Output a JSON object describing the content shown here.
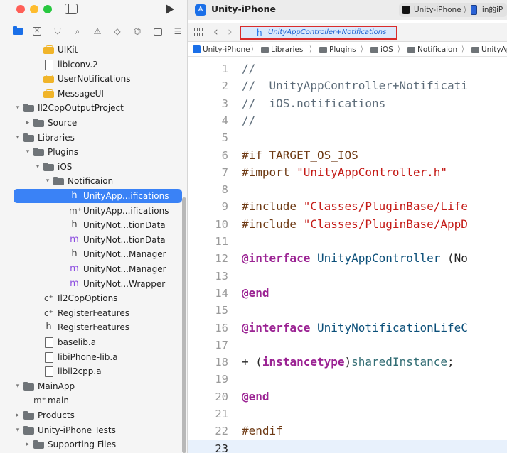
{
  "navigator": {
    "tree": [
      {
        "label": "UIKit",
        "icon": "framework-icon",
        "depth": 3,
        "chevron": ""
      },
      {
        "label": "libiconv.2",
        "icon": "file-icon",
        "depth": 3,
        "chevron": ""
      },
      {
        "label": "UserNotifications",
        "icon": "framework-icon",
        "depth": 3,
        "chevron": ""
      },
      {
        "label": "MessageUI",
        "icon": "framework-icon",
        "depth": 3,
        "chevron": ""
      },
      {
        "label": "Il2CppOutputProject",
        "icon": "folder-icon",
        "depth": 1,
        "chevron": "⌄"
      },
      {
        "label": "Source",
        "icon": "folder-icon",
        "depth": 2,
        "chevron": "›"
      },
      {
        "label": "Libraries",
        "icon": "folder-icon",
        "depth": 1,
        "chevron": "⌄"
      },
      {
        "label": "Plugins",
        "icon": "folder-icon",
        "depth": 2,
        "chevron": "⌄"
      },
      {
        "label": "iOS",
        "icon": "folder-icon",
        "depth": 3,
        "chevron": "⌄"
      },
      {
        "label": "Notificaion",
        "icon": "folder-icon",
        "depth": 4,
        "chevron": "⌄"
      },
      {
        "label": "UnityApp...ifications",
        "icon": "h-file-icon",
        "depth": 5,
        "chevron": "",
        "selected": true
      },
      {
        "label": "UnityApp...ifications",
        "icon": "mplus-file-icon",
        "depth": 5,
        "chevron": ""
      },
      {
        "label": "UnityNot...tionData",
        "icon": "h-file-icon",
        "depth": 5,
        "chevron": ""
      },
      {
        "label": "UnityNot...tionData",
        "icon": "m-file-icon",
        "depth": 5,
        "chevron": ""
      },
      {
        "label": "UnityNot...Manager",
        "icon": "h-file-icon",
        "depth": 5,
        "chevron": ""
      },
      {
        "label": "UnityNot...Manager",
        "icon": "m-file-icon",
        "depth": 5,
        "chevron": ""
      },
      {
        "label": "UnityNot...Wrapper",
        "icon": "m-file-icon",
        "depth": 5,
        "chevron": ""
      },
      {
        "label": "Il2CppOptions",
        "icon": "cplus-file-icon",
        "depth": 3,
        "chevron": ""
      },
      {
        "label": "RegisterFeatures",
        "icon": "cplus-file-icon",
        "depth": 3,
        "chevron": ""
      },
      {
        "label": "RegisterFeatures",
        "icon": "h-file-icon",
        "depth": 3,
        "chevron": ""
      },
      {
        "label": "baselib.a",
        "icon": "file-icon",
        "depth": 3,
        "chevron": ""
      },
      {
        "label": "libiPhone-lib.a",
        "icon": "file-icon",
        "depth": 3,
        "chevron": ""
      },
      {
        "label": "libil2cpp.a",
        "icon": "file-icon",
        "depth": 3,
        "chevron": ""
      },
      {
        "label": "MainApp",
        "icon": "folder-icon",
        "depth": 1,
        "chevron": "⌄"
      },
      {
        "label": "main",
        "icon": "mm-file-icon",
        "depth": 2,
        "chevron": ""
      },
      {
        "label": "Products",
        "icon": "folder-icon",
        "depth": 1,
        "chevron": "›"
      },
      {
        "label": "Unity-iPhone Tests",
        "icon": "folder-icon",
        "depth": 1,
        "chevron": "⌄"
      },
      {
        "label": "Supporting Files",
        "icon": "folder-icon",
        "depth": 2,
        "chevron": "›"
      }
    ]
  },
  "toolbar": {
    "scheme_title": "Unity-iPhone",
    "run_destination": {
      "scheme": "Unity-iPhone",
      "device": "lin的iP"
    }
  },
  "tabbar": {
    "active_tab_glyph": "h",
    "active_tab_label": "UnityAppController+Notifications"
  },
  "jumpbar": [
    "Unity-iPhone",
    "Libraries",
    "Plugins",
    "iOS",
    "Notificaion",
    "UnityApp"
  ],
  "editor": {
    "current_line": 23,
    "lines": [
      {
        "n": "1",
        "tokens": [
          {
            "t": "//",
            "c": "com"
          }
        ]
      },
      {
        "n": "2",
        "tokens": [
          {
            "t": "//  UnityAppController+Notificati",
            "c": "com"
          }
        ]
      },
      {
        "n": "3",
        "tokens": [
          {
            "t": "//  iOS.notifications",
            "c": "com"
          }
        ]
      },
      {
        "n": "4",
        "tokens": [
          {
            "t": "//",
            "c": "com"
          }
        ]
      },
      {
        "n": "5",
        "tokens": []
      },
      {
        "n": "6",
        "tokens": [
          {
            "t": "#if TARGET_OS_IOS",
            "c": "pre"
          }
        ]
      },
      {
        "n": "7",
        "tokens": [
          {
            "t": "#import ",
            "c": "pre"
          },
          {
            "t": "\"UnityAppController.h\"",
            "c": "str"
          }
        ]
      },
      {
        "n": "8",
        "tokens": []
      },
      {
        "n": "9",
        "tokens": [
          {
            "t": "#include ",
            "c": "pre"
          },
          {
            "t": "\"Classes/PluginBase/Life",
            "c": "str"
          }
        ]
      },
      {
        "n": "10",
        "tokens": [
          {
            "t": "#include ",
            "c": "pre"
          },
          {
            "t": "\"Classes/PluginBase/AppD",
            "c": "str"
          }
        ]
      },
      {
        "n": "11",
        "tokens": []
      },
      {
        "n": "12",
        "tokens": [
          {
            "t": "@interface",
            "c": "kw"
          },
          {
            "t": " ",
            "c": ""
          },
          {
            "t": "UnityAppController",
            "c": "type"
          },
          {
            "t": " (No",
            "c": ""
          }
        ]
      },
      {
        "n": "13",
        "tokens": []
      },
      {
        "n": "14",
        "tokens": [
          {
            "t": "@end",
            "c": "kw"
          }
        ]
      },
      {
        "n": "15",
        "tokens": []
      },
      {
        "n": "16",
        "tokens": [
          {
            "t": "@interface",
            "c": "kw"
          },
          {
            "t": " ",
            "c": ""
          },
          {
            "t": "UnityNotificationLifeC",
            "c": "type"
          }
        ]
      },
      {
        "n": "17",
        "tokens": []
      },
      {
        "n": "18",
        "tokens": [
          {
            "t": "+ (",
            "c": ""
          },
          {
            "t": "instancetype",
            "c": "kw"
          },
          {
            "t": ")",
            "c": ""
          },
          {
            "t": "sharedInstance",
            "c": "sel"
          },
          {
            "t": ";",
            "c": ""
          }
        ]
      },
      {
        "n": "19",
        "tokens": []
      },
      {
        "n": "20",
        "tokens": [
          {
            "t": "@end",
            "c": "kw"
          }
        ]
      },
      {
        "n": "21",
        "tokens": []
      },
      {
        "n": "22",
        "tokens": [
          {
            "t": "#endif",
            "c": "pre"
          }
        ]
      },
      {
        "n": "23",
        "tokens": []
      }
    ]
  }
}
